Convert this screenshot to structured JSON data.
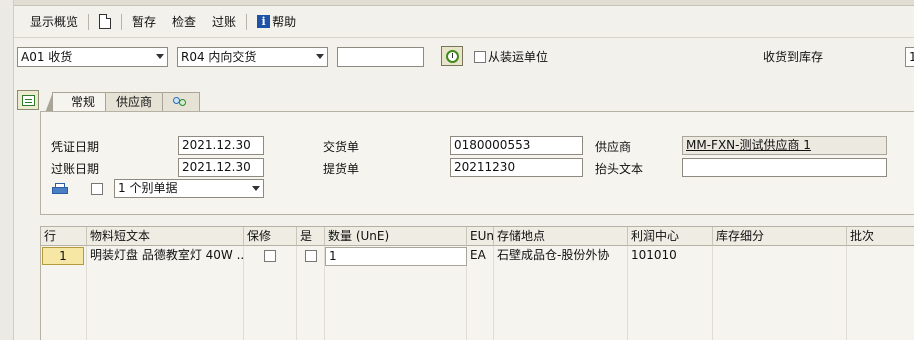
{
  "toolbar": {
    "overview": "显示概览",
    "hold": "暂存",
    "check": "检查",
    "post": "过账",
    "help": "帮助"
  },
  "header_row": {
    "action": "A01 收货",
    "mvt_type": "R04 内向交货",
    "ref_doc": "",
    "from_shipping_unit_label": "从装运单位",
    "receipt_label": "收货到库存",
    "receipt_value": "1"
  },
  "tabs": [
    "常规",
    "供应商"
  ],
  "general": {
    "doc_date_label": "凭证日期",
    "doc_date": "2021.12.30",
    "post_date_label": "过账日期",
    "post_date": "2021.12.30",
    "delivery_label": "交货单",
    "delivery": "0180000553",
    "bol_label": "提货单",
    "bol": "20211230",
    "vendor_label": "供应商",
    "vendor": "MM-FXN-测试供应商 1",
    "header_text_label": "抬头文本",
    "header_text": "",
    "print_select": "1 个别单据"
  },
  "grid": {
    "columns": [
      "行",
      "物料短文本",
      "保修",
      "是",
      "数量 (UnE)",
      "EUn",
      "存储地点",
      "利润中心",
      "库存细分",
      "批次"
    ],
    "rows": [
      {
        "line": "1",
        "material": "明装灯盘 品德教室灯 40W ..",
        "quantity": "1",
        "unit": "EA",
        "storage": "石壁成品仓-股份外协",
        "profit_center": "101010"
      }
    ]
  }
}
